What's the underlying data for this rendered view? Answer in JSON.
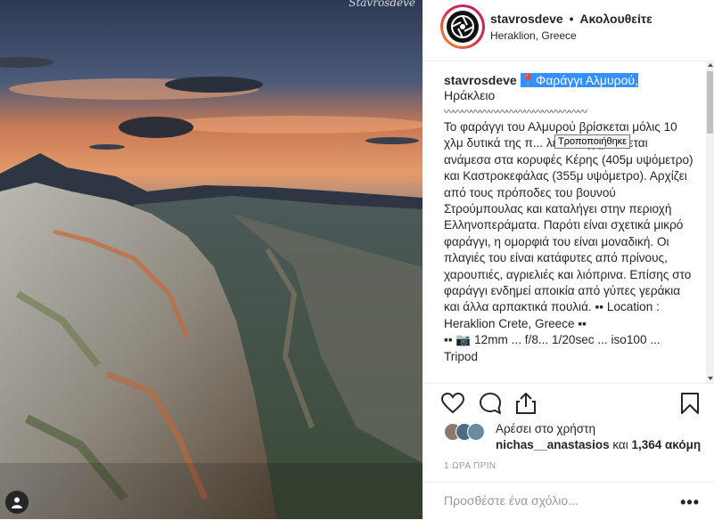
{
  "photo": {
    "watermark": "Stavrosdeve"
  },
  "header": {
    "username": "stavrosdeve",
    "separator": "•",
    "follow_status": "Ακολουθείτε",
    "location": "Heraklion, Greece"
  },
  "caption": {
    "author": "stavrosdeve",
    "pin": "📍",
    "title": "Φαράγγι Αλμυρού,",
    "line2": "Ηράκλειο",
    "divider": "〰〰〰〰〰〰〰〰〰〰〰〰〰〰〰〰",
    "body": "Το φαράγγι του Αλμυρού βρίσκεται μόλις 10 χλμ δυτικά της π... λείου. Σχηματίζεται ανάμεσα στα κορυφές Κέρης (405μ υψόμετρο) και Καστροκεφάλας (355μ υψόμετρο). Αρχίζει από τους πρόποδες του βουνού Στρούμπουλας και καταλήγει στην περιοχή Ελληνοπεράματα. Παρότι είναι σχετικά μικρό φαράγγι, η ομορφιά του είναι μοναδική. Οι πλαγιές του είναι κατάφυτες από πρίνους, χαρουπιές, αγριελιές και λιόπρινα. Επίσης στο φαράγγι ενδημεί αποικία από γύπες γεράκια και άλλα αρπακτικά πουλιά. ▪▪ Location : Heraklion Crete, Greece ▪▪\n▪▪ 📷 12mm ... f/8... 1/20sec ... iso100 ...\nTripod",
    "tooltip": "Τροποποιήθηκε"
  },
  "actions": {
    "like_icon": "heart-icon",
    "comment_icon": "comment-icon",
    "share_icon": "share-icon",
    "save_icon": "bookmark-icon"
  },
  "likes": {
    "liked_by": "Αρέσει στο χρήστη",
    "liker": "nichas__anastasios",
    "and": " και ",
    "count": "1,364 ακόμη"
  },
  "timestamp": "1 ΩΡΑ ΠΡΙΝ",
  "comment": {
    "placeholder": "Προσθέστε ένα σχόλιο...",
    "more": "•••"
  }
}
